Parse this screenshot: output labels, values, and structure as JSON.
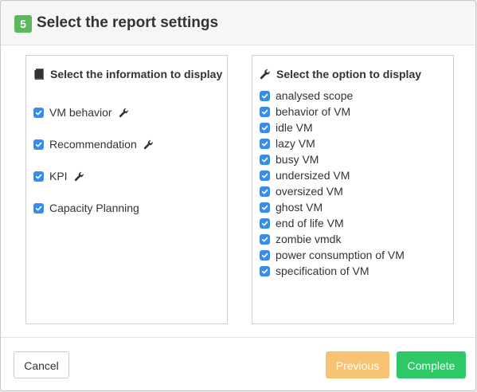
{
  "header": {
    "step_number": "5",
    "title": "Select the report settings"
  },
  "info_panel": {
    "heading": "Select the information to display",
    "items": [
      {
        "label": "VM behavior",
        "checked": true,
        "has_config": true
      },
      {
        "label": "Recommendation",
        "checked": true,
        "has_config": true
      },
      {
        "label": "KPI",
        "checked": true,
        "has_config": true
      },
      {
        "label": "Capacity Planning",
        "checked": true,
        "has_config": false
      }
    ]
  },
  "option_panel": {
    "heading": "Select the option to display",
    "items": [
      {
        "label": "analysed scope",
        "checked": true
      },
      {
        "label": "behavior of VM",
        "checked": true
      },
      {
        "label": "idle VM",
        "checked": true
      },
      {
        "label": "lazy VM",
        "checked": true
      },
      {
        "label": "busy VM",
        "checked": true
      },
      {
        "label": "undersized VM",
        "checked": true
      },
      {
        "label": "oversized VM",
        "checked": true
      },
      {
        "label": "ghost VM",
        "checked": true
      },
      {
        "label": "end of life VM",
        "checked": true
      },
      {
        "label": "zombie vmdk",
        "checked": true
      },
      {
        "label": "power consumption of VM",
        "checked": true
      },
      {
        "label": "specification of VM",
        "checked": true
      }
    ]
  },
  "footer": {
    "cancel_label": "Cancel",
    "previous_label": "Previous",
    "complete_label": "Complete"
  },
  "colors": {
    "step_badge": "#5cb85c",
    "checkbox": "#3a8de6",
    "previous_button": "#f8c273",
    "complete_button": "#2ec866"
  },
  "icons": {
    "info_heading": "book-icon",
    "option_heading": "wrench-icon",
    "item_config": "wrench-icon"
  }
}
